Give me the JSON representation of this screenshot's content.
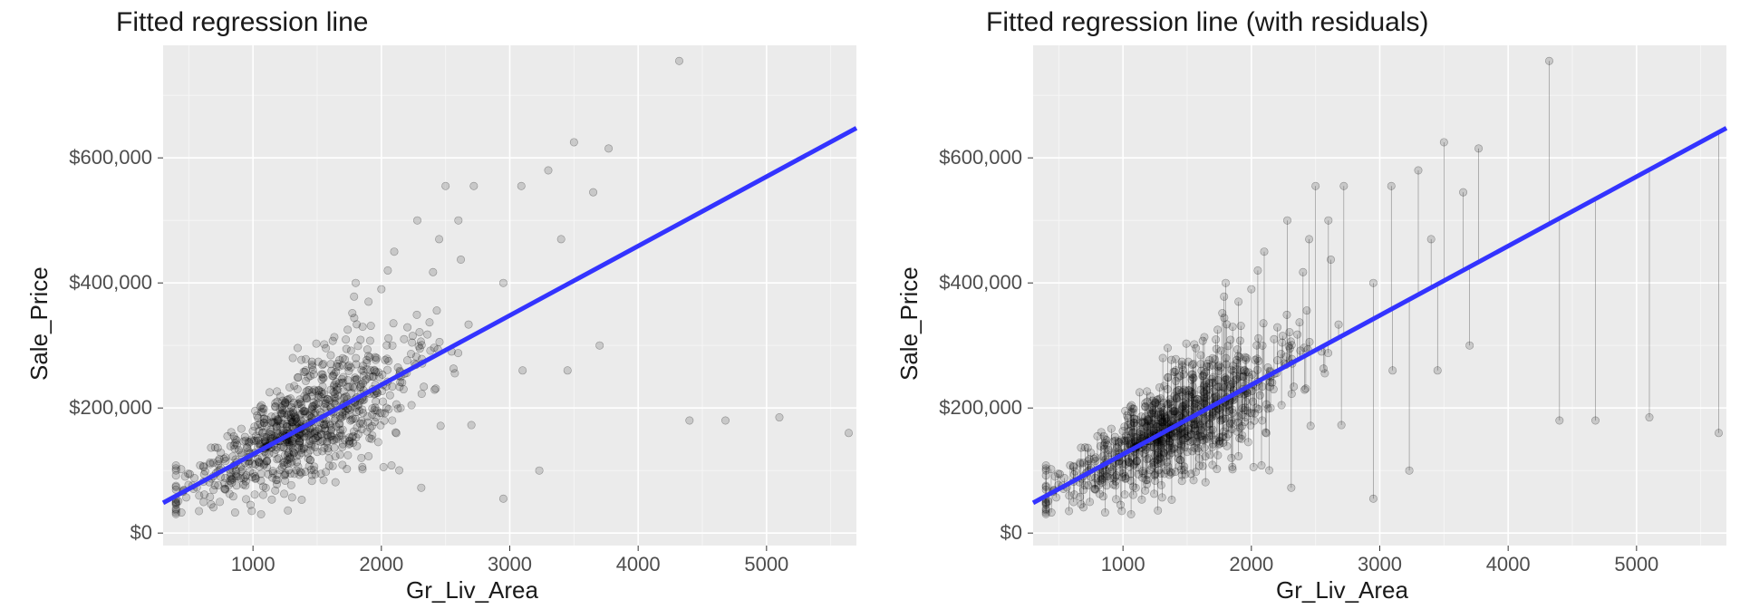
{
  "chart_data": [
    {
      "type": "scatter",
      "title": "Fitted regression line",
      "xlabel": "Gr_Liv_Area",
      "ylabel": "Sale_Price",
      "xlim": [
        300,
        5700
      ],
      "ylim": [
        -20000,
        780000
      ],
      "x_ticks": [
        1000,
        2000,
        3000,
        4000,
        5000
      ],
      "y_ticks": [
        0,
        200000,
        400000,
        600000
      ],
      "y_tick_labels": [
        "$0",
        "$200,000",
        "$400,000",
        "$600,000"
      ],
      "regression": {
        "intercept": 15000,
        "slope": 111
      },
      "show_residuals": false
    },
    {
      "type": "scatter",
      "title": "Fitted regression line (with residuals)",
      "xlabel": "Gr_Liv_Area",
      "ylabel": "Sale_Price",
      "xlim": [
        300,
        5700
      ],
      "ylim": [
        -20000,
        780000
      ],
      "x_ticks": [
        1000,
        2000,
        3000,
        4000,
        5000
      ],
      "y_ticks": [
        0,
        200000,
        400000,
        600000
      ],
      "y_tick_labels": [
        "$0",
        "$200,000",
        "$400,000",
        "$600,000"
      ],
      "regression": {
        "intercept": 15000,
        "slope": 111
      },
      "show_residuals": true
    }
  ],
  "panel0": {
    "title": "Fitted regression line",
    "xlabel": "Gr_Liv_Area",
    "ylabel": "Sale_Price"
  },
  "panel1": {
    "title": "Fitted regression line (with residuals)",
    "xlabel": "Gr_Liv_Area",
    "ylabel": "Sale_Price"
  }
}
